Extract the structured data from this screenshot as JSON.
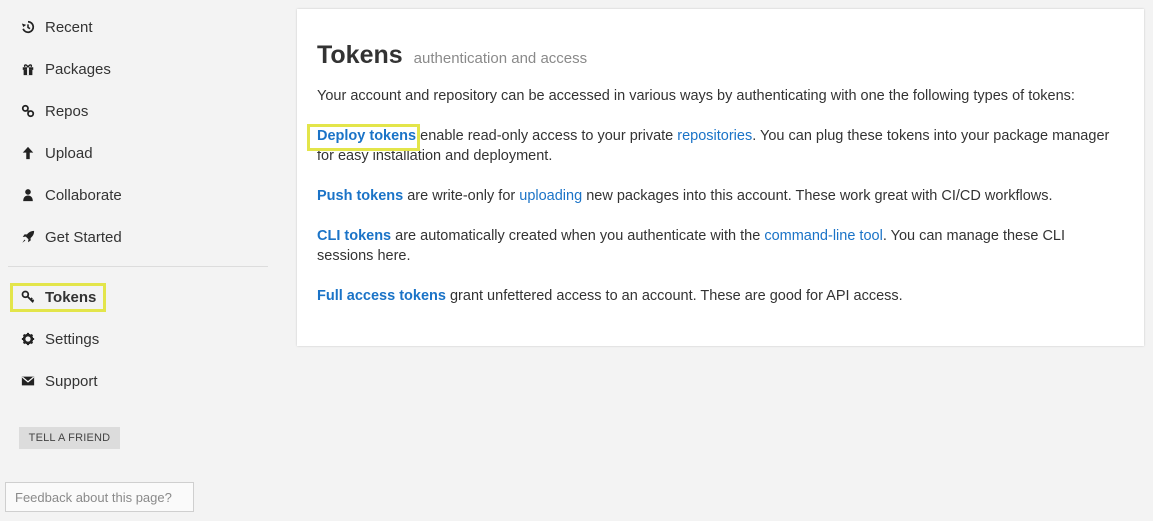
{
  "sidebar": {
    "items": [
      {
        "label": "Recent",
        "icon": "history-icon"
      },
      {
        "label": "Packages",
        "icon": "gift-icon"
      },
      {
        "label": "Repos",
        "icon": "link-icon"
      },
      {
        "label": "Upload",
        "icon": "arrow-up-icon"
      },
      {
        "label": "Collaborate",
        "icon": "user-icon"
      },
      {
        "label": "Get Started",
        "icon": "rocket-icon"
      },
      {
        "label": "Tokens",
        "icon": "key-icon",
        "active": true
      },
      {
        "label": "Settings",
        "icon": "gear-icon"
      },
      {
        "label": "Support",
        "icon": "envelope-icon"
      }
    ],
    "tell_friend": "TELL A FRIEND",
    "feedback_placeholder": "Feedback about this page?"
  },
  "main": {
    "title": "Tokens",
    "subtitle": "authentication and access",
    "intro": "Your account and repository can be accessed in various ways by authenticating with one the following types of tokens:",
    "deploy": {
      "name": "Deploy tokens",
      "text1": " enable read-only access to your private ",
      "link": "repositories",
      "text2": ". You can plug these tokens into your package manager for easy installation and deployment."
    },
    "push": {
      "name": "Push tokens",
      "text1": " are write-only for ",
      "link": "uploading",
      "text2": " new packages into this account. These work great with CI/CD workflows."
    },
    "cli": {
      "name": "CLI tokens",
      "text1": " are automatically created when you authenticate with the ",
      "link": "command-line tool",
      "text2": ". You can manage these CLI sessions here."
    },
    "full": {
      "name": "Full access tokens",
      "text1": " grant unfettered access to an account. These are good for API access."
    }
  },
  "colors": {
    "link": "#1a73c7",
    "highlight": "#e3e54a",
    "background": "#f3f3f3"
  }
}
